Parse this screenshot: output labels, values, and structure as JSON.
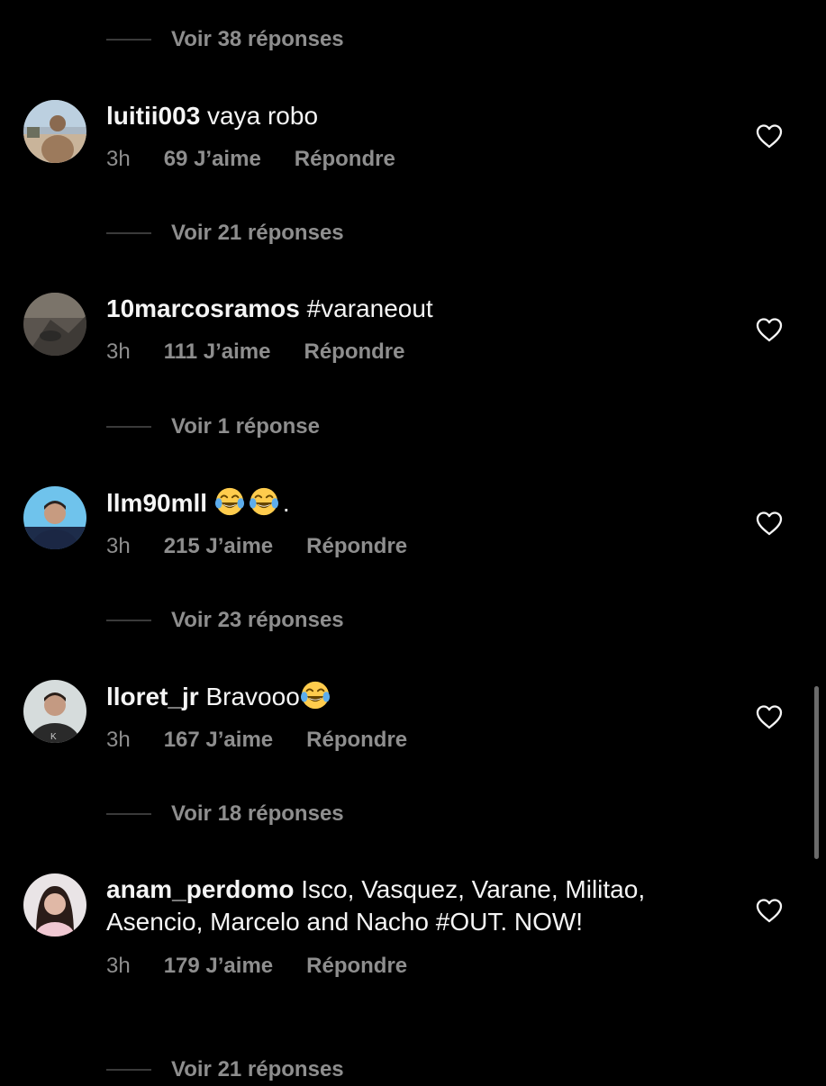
{
  "colors": {
    "background": "#000000",
    "text_primary": "#f5f5f5",
    "text_secondary": "#8e8e8e",
    "divider": "#3a3a3a"
  },
  "replies_toggles": [
    {
      "label": "Voir 38 réponses"
    },
    {
      "label": "Voir 21 réponses"
    },
    {
      "label": "Voir 1 réponse"
    },
    {
      "label": "Voir 23 réponses"
    },
    {
      "label": "Voir 18 réponses"
    },
    {
      "label": "Voir 21 réponses"
    }
  ],
  "comments": [
    {
      "username": "luitii003",
      "text": "vaya robo",
      "time": "3h",
      "likes": "69 J’aime",
      "reply": "Répondre",
      "icon": "heart-outline-icon"
    },
    {
      "username": "10marcosramos",
      "text": "#varaneout",
      "time": "3h",
      "likes": "111 J’aime",
      "reply": "Répondre",
      "icon": "heart-outline-icon"
    },
    {
      "username": "llm90mll",
      "text": ".",
      "emojis": [
        "face-with-tears-of-joy",
        "face-with-tears-of-joy"
      ],
      "time": "3h",
      "likes": "215 J’aime",
      "reply": "Répondre",
      "icon": "heart-outline-icon"
    },
    {
      "username": "lloret_jr",
      "text": "Bravooo",
      "emojis": [
        "face-with-tears-of-joy"
      ],
      "time": "3h",
      "likes": "167 J’aime",
      "reply": "Répondre",
      "icon": "heart-outline-icon"
    },
    {
      "username": "anam_perdomo",
      "text": "Isco, Vasquez, Varane, Militao, Asencio, Marcelo and Nacho #OUT. NOW!",
      "time": "3h",
      "likes": "179 J’aime",
      "reply": "Répondre",
      "icon": "heart-outline-icon"
    }
  ]
}
